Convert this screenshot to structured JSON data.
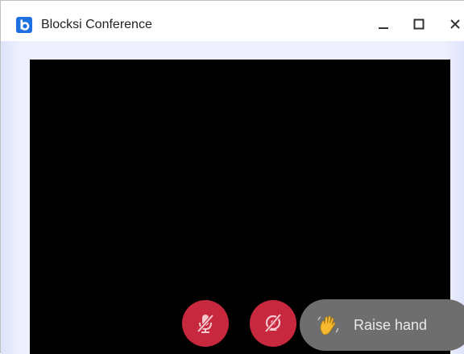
{
  "window": {
    "title": "Blocksi Conference",
    "app_icon": "blocksi-logo-icon",
    "controls": [
      "minimize-icon",
      "maximize-icon",
      "close-icon"
    ]
  },
  "call_controls": {
    "mic_button": {
      "icon": "microphone-off-icon",
      "state": "muted"
    },
    "camera_button": {
      "icon": "camera-off-icon",
      "state": "off"
    },
    "raise_hand": {
      "icon": "waving-hand-icon",
      "label": "Raise hand"
    }
  },
  "colors": {
    "accent_blue": "#1e6fe0",
    "control_red": "#c8283e",
    "raise_hand_bg": "#6e6e6e",
    "video_bg": "#000000",
    "frame_bg": "#eef0fd"
  }
}
